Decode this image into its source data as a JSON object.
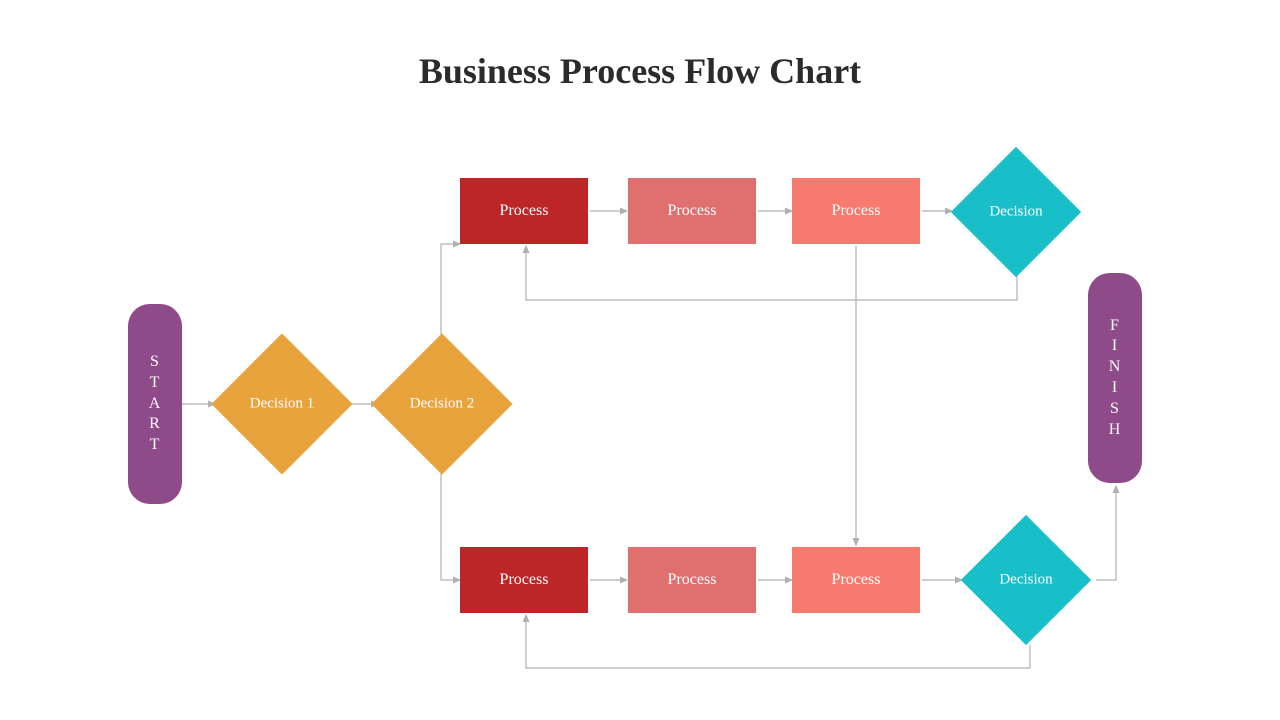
{
  "title": "Business Process Flow Chart",
  "colors": {
    "purple": "#8e4a89",
    "orange": "#e8a33d",
    "red1": "#bd2626",
    "red2": "#e06f6f",
    "red3": "#f77a6e",
    "teal": "#18bfc9",
    "arrow": "#b0b0b0"
  },
  "nodes": {
    "start": "START",
    "decision1": "Decision 1",
    "decision2": "Decision 2",
    "topProcess1": "Process",
    "topProcess2": "Process",
    "topProcess3": "Process",
    "topDecision": "Decision",
    "botProcess1": "Process",
    "botProcess2": "Process",
    "botProcess3": "Process",
    "botDecision": "Decision",
    "finish": "FINISH"
  },
  "chart_data": {
    "type": "flowchart",
    "title": "Business Process Flow Chart",
    "nodes": [
      {
        "id": "start",
        "type": "terminator",
        "label": "START",
        "color": "#8e4a89"
      },
      {
        "id": "d1",
        "type": "decision",
        "label": "Decision 1",
        "color": "#e8a33d"
      },
      {
        "id": "d2",
        "type": "decision",
        "label": "Decision 2",
        "color": "#e8a33d"
      },
      {
        "id": "p1a",
        "type": "process",
        "label": "Process",
        "color": "#bd2626"
      },
      {
        "id": "p2a",
        "type": "process",
        "label": "Process",
        "color": "#e06f6f"
      },
      {
        "id": "p3a",
        "type": "process",
        "label": "Process",
        "color": "#f77a6e"
      },
      {
        "id": "da",
        "type": "decision",
        "label": "Decision",
        "color": "#18bfc9"
      },
      {
        "id": "p1b",
        "type": "process",
        "label": "Process",
        "color": "#bd2626"
      },
      {
        "id": "p2b",
        "type": "process",
        "label": "Process",
        "color": "#e06f6f"
      },
      {
        "id": "p3b",
        "type": "process",
        "label": "Process",
        "color": "#f77a6e"
      },
      {
        "id": "db",
        "type": "decision",
        "label": "Decision",
        "color": "#18bfc9"
      },
      {
        "id": "finish",
        "type": "terminator",
        "label": "FINISH",
        "color": "#8e4a89"
      }
    ],
    "edges": [
      {
        "from": "start",
        "to": "d1"
      },
      {
        "from": "d1",
        "to": "d2"
      },
      {
        "from": "d2",
        "to": "p1a"
      },
      {
        "from": "d2",
        "to": "p1b"
      },
      {
        "from": "p1a",
        "to": "p2a"
      },
      {
        "from": "p2a",
        "to": "p3a"
      },
      {
        "from": "p3a",
        "to": "da"
      },
      {
        "from": "da",
        "to": "p1a",
        "note": "loop back"
      },
      {
        "from": "p1b",
        "to": "p2b"
      },
      {
        "from": "p2b",
        "to": "p3b"
      },
      {
        "from": "p3b",
        "to": "db"
      },
      {
        "from": "p3a",
        "to": "p3b",
        "note": "cross link"
      },
      {
        "from": "db",
        "to": "p1b",
        "note": "loop back"
      },
      {
        "from": "db",
        "to": "finish"
      }
    ]
  }
}
